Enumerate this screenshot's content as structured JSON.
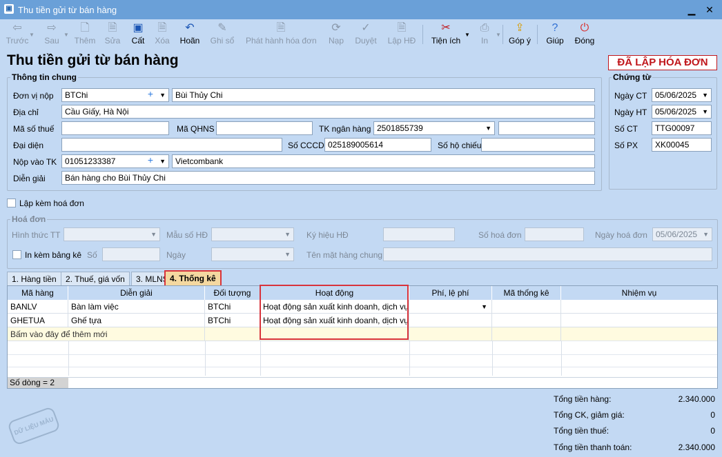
{
  "window": {
    "title": "Thu tiền gửi từ bán hàng"
  },
  "toolbar": {
    "prev": "Trước",
    "next": "Sau",
    "add": "Thêm",
    "edit": "Sửa",
    "save": "Cất",
    "delete": "Xóa",
    "undo": "Hoãn",
    "post": "Ghi sổ",
    "issue_invoice": "Phát hành hóa đơn",
    "reload": "Nạp",
    "approve": "Duyệt",
    "make_invoice": "Lập HĐ",
    "utilities": "Tiện ích",
    "print": "In",
    "feedback": "Góp ý",
    "help": "Giúp",
    "close": "Đóng"
  },
  "page_title": "Thu tiền gửi từ bán hàng",
  "invoice_status": "ĐÃ LẬP HÓA ĐƠN",
  "general": {
    "section": "Thông tin chung",
    "payer_label": "Đơn vị nộp",
    "payer_code": "BTChi",
    "payer_name": "Bùi Thủy Chi",
    "address_label": "Địa chỉ",
    "address": "Cầu Giấy, Hà Nội",
    "tax_label": "Mã số thuế",
    "tax": "",
    "qhns_label": "Mã QHNS",
    "qhns": "",
    "bank_acc_label": "TK ngân hàng",
    "bank_acc": "2501855739",
    "bank_acc_extra": "",
    "rep_label": "Đại diện",
    "rep": "",
    "cccd_label": "Số CCCD",
    "cccd": "025189005614",
    "passport_label": "Số hộ chiếu",
    "passport": "",
    "deposit_label": "Nộp vào TK",
    "deposit_acc": "01051233387",
    "deposit_bank": "Vietcombank",
    "desc_label": "Diễn giải",
    "desc": "Bán hàng cho Bùi Thủy Chi"
  },
  "voucher": {
    "section": "Chứng từ",
    "date_ct_label": "Ngày CT",
    "date_ct": "05/06/2025",
    "date_ht_label": "Ngày HT",
    "date_ht": "05/06/2025",
    "no_ct_label": "Số CT",
    "no_ct": "TTG00097",
    "no_px_label": "Số PX",
    "no_px": "XK00045"
  },
  "attach_invoice_label": "Lập kèm hoá đơn",
  "invoice": {
    "section": "Hoá đơn",
    "payment_label": "Hình thức TT",
    "template_label": "Mẫu số HĐ",
    "symbol_label": "Ký hiệu HĐ",
    "number_label": "Số hoá đơn",
    "date_label": "Ngày hoá đơn",
    "date": "05/06/2025",
    "print_list_label": "In kèm bảng kê",
    "no_label": "Số",
    "day_label": "Ngày",
    "goods_label": "Tên mặt hàng chung"
  },
  "tabs": [
    "1. Hàng tiền",
    "2. Thuế, giá vốn",
    "3. MLNS",
    "4. Thống kê"
  ],
  "grid": {
    "columns": [
      "Mã hàng",
      "Diễn giải",
      "Đối tượng",
      "Hoạt động",
      "Phí, lệ phí",
      "Mã thống kê",
      "Nhiệm vụ"
    ],
    "rows": [
      {
        "code": "BANLV",
        "desc": "Bàn làm việc",
        "obj": "BTChi",
        "activity": "Hoạt động sản xuất kinh doanh, dịch vụ"
      },
      {
        "code": "GHETUA",
        "desc": "Ghế tựa",
        "obj": "BTChi",
        "activity": "Hoạt động sản xuất kinh doanh, dịch vụ"
      }
    ],
    "add_row": "Bấm vào đây để thêm mới",
    "row_count": "Số dòng = 2"
  },
  "totals": {
    "goods_label": "Tổng tiền hàng:",
    "goods": "2.340.000",
    "discount_label": "Tổng CK, giảm giá:",
    "discount": "0",
    "tax_label": "Tổng tiền thuế:",
    "tax": "0",
    "payment_label": "Tổng tiền thanh toán:",
    "payment": "2.340.000"
  },
  "watermark": "DỮ LIỆU MẪU"
}
